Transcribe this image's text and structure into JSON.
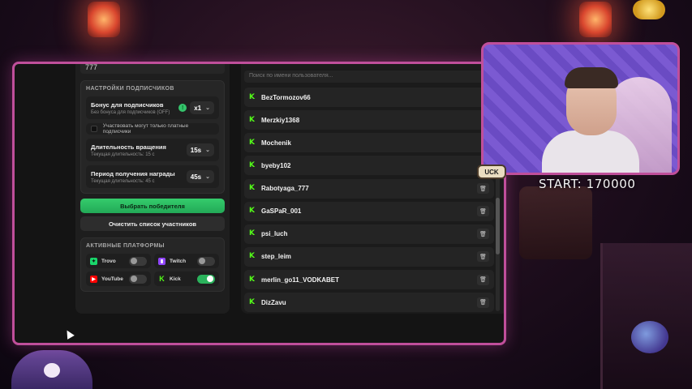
{
  "stream_overlay": {
    "start_label": "START: 170000",
    "luck_badge": "UCK"
  },
  "left_panel": {
    "seed_value": "777",
    "subscriber_settings": {
      "title": "НАСТРОЙКИ ПОДПИСЧИКОВ",
      "bonus": {
        "label": "Бонус для подписчиков",
        "sub": "Без бонуса для подписчиков (OFF)",
        "info": "!",
        "value": "x1"
      },
      "paid_only_label": "Участвовать могут только платные подписчики",
      "spin_duration": {
        "label": "Длительность вращения",
        "sub": "Текущая длительность: 15 с",
        "value": "15s"
      },
      "reward_period": {
        "label": "Период получения награды",
        "sub": "Текущая длительность: 45 с",
        "value": "45s"
      }
    },
    "pick_winner_button": "Выбрать победителя",
    "clear_list_button": "Очистить список участников",
    "platforms": {
      "title": "АКТИВНЫЕ ПЛАТФОРМЫ",
      "items": [
        {
          "name": "Trovo",
          "enabled": false,
          "color": "#19d66b"
        },
        {
          "name": "Twitch",
          "enabled": false,
          "color": "#9146ff"
        },
        {
          "name": "YouTube",
          "enabled": false,
          "color": "#ff0000"
        },
        {
          "name": "Kick",
          "enabled": true,
          "color": "#53fc18"
        }
      ]
    }
  },
  "right_panel": {
    "search_placeholder": "Поиск по имени пользователя...",
    "users": [
      {
        "name": "BezTormozov66",
        "show_trash": false
      },
      {
        "name": "Merzkiy1368",
        "show_trash": false
      },
      {
        "name": "Mochenik",
        "show_trash": false
      },
      {
        "name": "byeby102",
        "show_trash": false
      },
      {
        "name": "Rabotyaga_777",
        "show_trash": true
      },
      {
        "name": "GaSPaR_001",
        "show_trash": true
      },
      {
        "name": "psi_luch",
        "show_trash": true
      },
      {
        "name": "step_leim",
        "show_trash": true
      },
      {
        "name": "merlin_go11_VODKABET",
        "show_trash": true
      },
      {
        "name": "DizZavu",
        "show_trash": true
      }
    ],
    "platform_icon": "kick-icon",
    "trash_icon": "trash-icon"
  },
  "colors": {
    "accent_green": "#2bb35c",
    "window_border": "#c04f9b",
    "kick_green": "#53fc18"
  }
}
